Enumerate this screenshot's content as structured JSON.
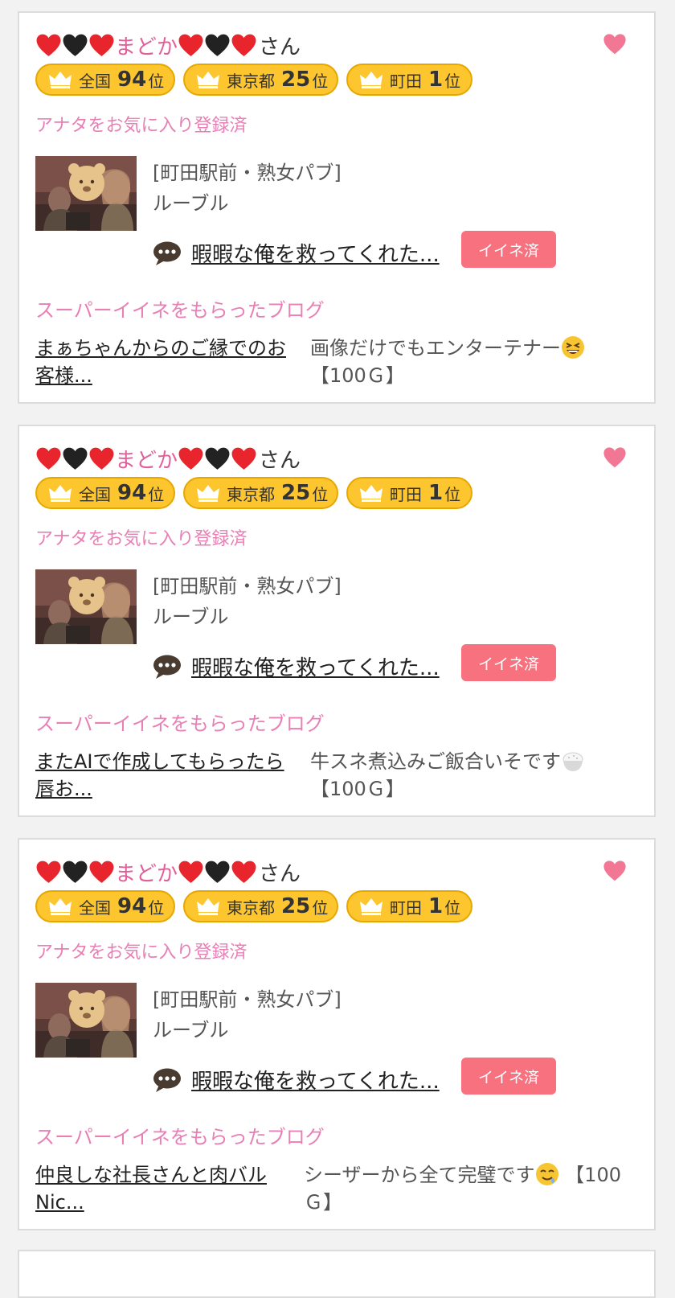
{
  "colors": {
    "accent_pink": "#e87fb5",
    "name_pink": "#e0609a",
    "badge_yellow": "#fdc52e",
    "iine_button": "#f7717f",
    "heart_red": "#e8252c",
    "heart_black": "#222222"
  },
  "posts": [
    {
      "user": {
        "name": "まどか",
        "suffix": "さん",
        "decor_left": [
          "red-heart",
          "black-heart",
          "red-heart"
        ],
        "decor_right": [
          "red-heart",
          "black-heart",
          "red-heart"
        ]
      },
      "favorite_icon": "heart-icon",
      "ranks": [
        {
          "area": "全国",
          "rank": "94",
          "unit": "位"
        },
        {
          "area": "東京都",
          "rank": "25",
          "unit": "位"
        },
        {
          "area": "町田",
          "rank": "1",
          "unit": "位"
        }
      ],
      "favorite_status": "アナタをお気に入り登録済",
      "shop": {
        "area": "[町田駅前・熟女パブ]",
        "name": "ルーブル"
      },
      "comment": {
        "icon": "speech-bubble-icon",
        "text": "暇暇な俺を救ってくれた..."
      },
      "iine_label": "イイネ済",
      "super_label": "スーパーイイネをもらったブログ",
      "blog": {
        "title": "まぁちゃんからのご縁でのお客様...",
        "comment": "画像だけでもエンターテナー",
        "emoji": "grinning-squint-emoji",
        "reward": "【100Ｇ】"
      }
    },
    {
      "user": {
        "name": "まどか",
        "suffix": "さん",
        "decor_left": [
          "red-heart",
          "black-heart",
          "red-heart"
        ],
        "decor_right": [
          "red-heart",
          "black-heart",
          "red-heart"
        ]
      },
      "favorite_icon": "heart-icon",
      "ranks": [
        {
          "area": "全国",
          "rank": "94",
          "unit": "位"
        },
        {
          "area": "東京都",
          "rank": "25",
          "unit": "位"
        },
        {
          "area": "町田",
          "rank": "1",
          "unit": "位"
        }
      ],
      "favorite_status": "アナタをお気に入り登録済",
      "shop": {
        "area": "[町田駅前・熟女パブ]",
        "name": "ルーブル"
      },
      "comment": {
        "icon": "speech-bubble-icon",
        "text": "暇暇な俺を救ってくれた..."
      },
      "iine_label": "イイネ済",
      "super_label": "スーパーイイネをもらったブログ",
      "blog": {
        "title": "またAIで作成してもらったら唇お...",
        "comment": "牛スネ煮込みご飯合いそです",
        "emoji": "rice-bowl-emoji",
        "reward": "【100Ｇ】"
      }
    },
    {
      "user": {
        "name": "まどか",
        "suffix": "さん",
        "decor_left": [
          "red-heart",
          "black-heart",
          "red-heart"
        ],
        "decor_right": [
          "red-heart",
          "black-heart",
          "red-heart"
        ]
      },
      "favorite_icon": "heart-icon",
      "ranks": [
        {
          "area": "全国",
          "rank": "94",
          "unit": "位"
        },
        {
          "area": "東京都",
          "rank": "25",
          "unit": "位"
        },
        {
          "area": "町田",
          "rank": "1",
          "unit": "位"
        }
      ],
      "favorite_status": "アナタをお気に入り登録済",
      "shop": {
        "area": "[町田駅前・熟女パブ]",
        "name": "ルーブル"
      },
      "comment": {
        "icon": "speech-bubble-icon",
        "text": "暇暇な俺を救ってくれた..."
      },
      "iine_label": "イイネ済",
      "super_label": "スーパーイイネをもらったブログ",
      "blog": {
        "title": "仲良しな社長さんと肉バル Nic...",
        "comment": "シーザーから全て完璧です",
        "emoji": "relieved-drool-emoji",
        "reward": "【100Ｇ】"
      }
    }
  ]
}
